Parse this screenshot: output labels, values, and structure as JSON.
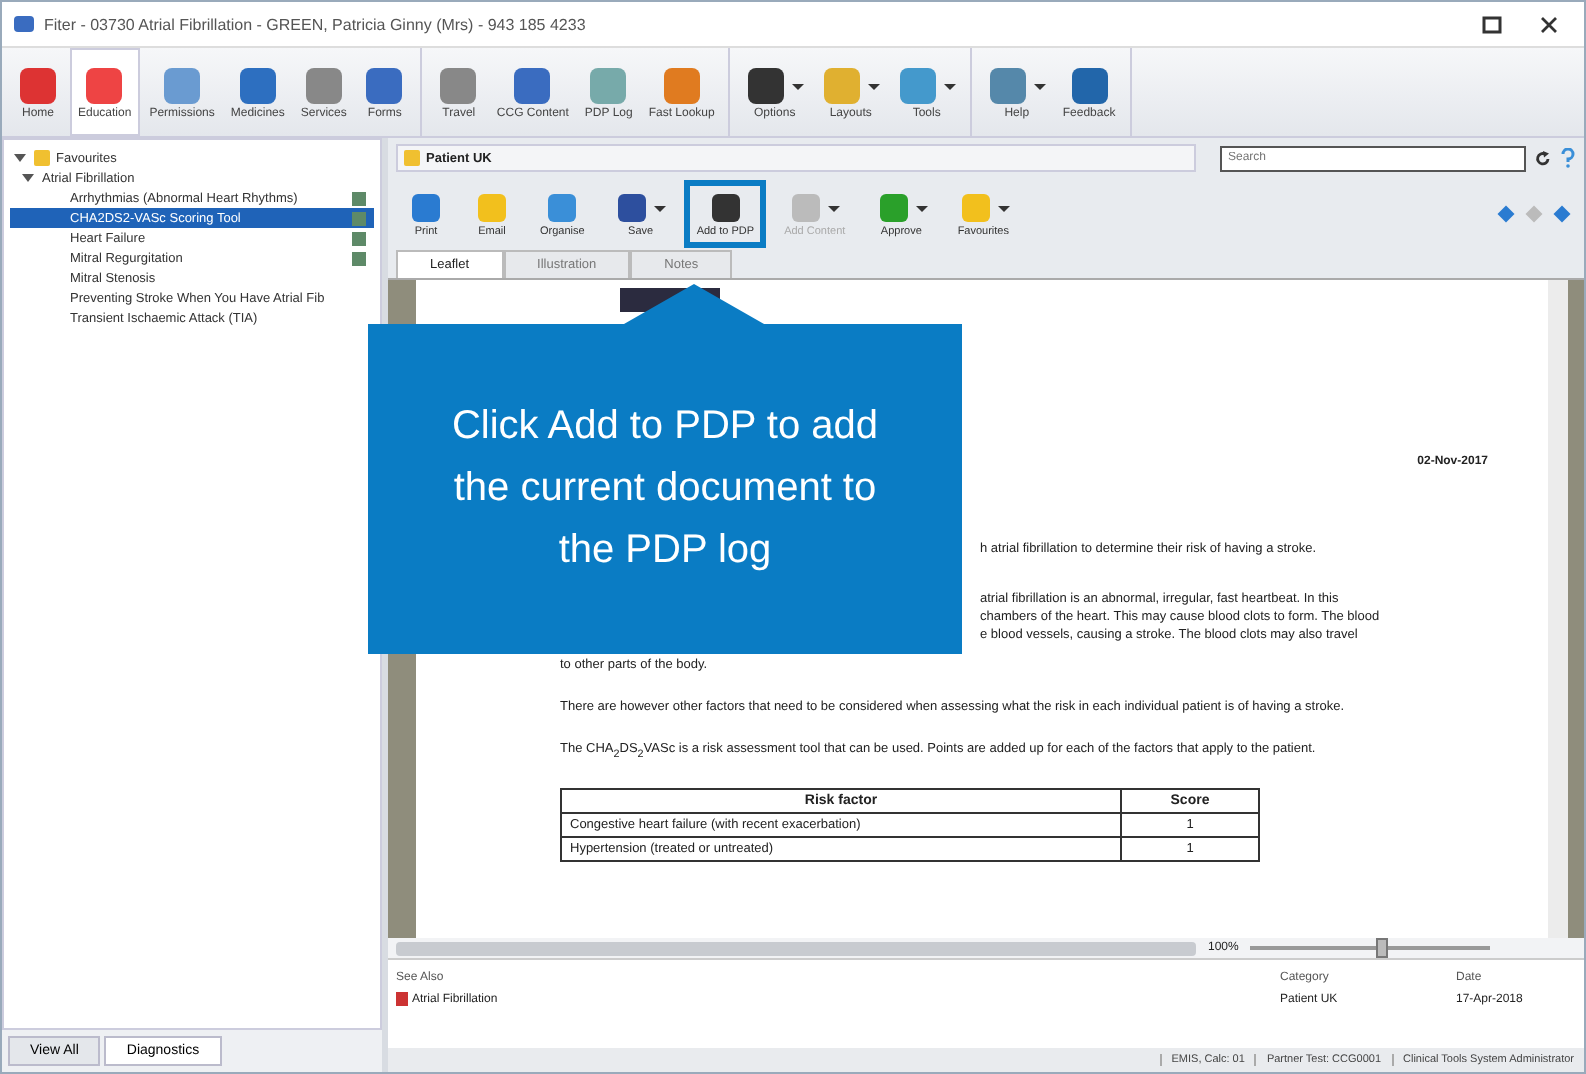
{
  "window": {
    "title": "Fiter - 03730 Atrial Fibrillation - GREEN, Patricia Ginny (Mrs) - 943 185 4233"
  },
  "ribbon": {
    "groups": [
      [
        {
          "label": "Home",
          "selected": false
        },
        {
          "label": "Education",
          "selected": true
        },
        {
          "label": "Permissions",
          "selected": false
        },
        {
          "label": "Medicines",
          "selected": false
        },
        {
          "label": "Services",
          "selected": false
        },
        {
          "label": "Forms",
          "selected": false
        }
      ],
      [
        {
          "label": "Travel",
          "selected": false
        },
        {
          "label": "CCG Content",
          "selected": false
        },
        {
          "label": "PDP Log",
          "selected": false
        },
        {
          "label": "Fast Lookup",
          "selected": false
        }
      ],
      [
        {
          "label": "Options",
          "dropdown": true
        },
        {
          "label": "Layouts",
          "dropdown": true
        },
        {
          "label": "Tools",
          "dropdown": true
        }
      ],
      [
        {
          "label": "Help",
          "dropdown": true
        },
        {
          "label": "Feedback",
          "dropdown": false
        }
      ]
    ]
  },
  "sidebar": {
    "tree": [
      {
        "label": "Favourites",
        "expanded": true,
        "children": [
          {
            "label": "Atrial Fibrillation",
            "expanded": true,
            "children": [
              {
                "label": "Arrhythmias (Abnormal Heart Rhythms)",
                "selected": false,
                "marked": true
              },
              {
                "label": "CHA2DS2-VASc Scoring Tool",
                "selected": true,
                "marked": true
              },
              {
                "label": "Heart Failure",
                "selected": false,
                "marked": true
              },
              {
                "label": "Mitral Regurgitation",
                "selected": false,
                "marked": true
              },
              {
                "label": "Mitral Stenosis",
                "selected": false,
                "marked": false
              },
              {
                "label": "Preventing Stroke When You Have Atrial Fib",
                "selected": false,
                "marked": false
              },
              {
                "label": "Transient Ischaemic Attack (TIA)",
                "selected": false,
                "marked": false
              }
            ]
          }
        ]
      }
    ],
    "buttons": [
      {
        "label": "View All",
        "selected": false
      },
      {
        "label": "Diagnostics",
        "selected": true
      }
    ]
  },
  "document": {
    "source": "Patient UK",
    "search": {
      "placeholder": "Search"
    },
    "toolbar": [
      {
        "label": "Print",
        "disabled": false,
        "dropdown": false
      },
      {
        "label": "Email",
        "disabled": false,
        "dropdown": false
      },
      {
        "label": "Organise",
        "disabled": false,
        "dropdown": false
      },
      {
        "label": "Save",
        "disabled": false,
        "dropdown": true
      },
      {
        "label": "Add to PDP",
        "disabled": false,
        "dropdown": false,
        "highlighted": true
      },
      {
        "label": "Add Content",
        "disabled": true,
        "dropdown": true
      },
      {
        "label": "Approve",
        "disabled": false,
        "dropdown": true
      },
      {
        "label": "Favourites",
        "disabled": false,
        "dropdown": true
      }
    ],
    "tabs": [
      {
        "label": "Leaflet",
        "selected": true
      },
      {
        "label": "Illustration",
        "selected": false
      },
      {
        "label": "Notes",
        "selected": false
      }
    ],
    "date": "02-Nov-2017",
    "partial_lines": [
      "h atrial fibrillation to determine their risk of having a stroke.",
      "atrial fibrillation is an abnormal, irregular, fast heartbeat. In this",
      "chambers of the heart. This may cause blood clots to form. The blood",
      "e blood vessels, causing a stroke. The blood clots may also travel"
    ],
    "paragraphs": [
      "to other parts of the body.",
      "There are however other factors that need to be considered when assessing what the risk in each individual patient is of having a stroke.",
      "The CHA$_{2}$DS$_{2}$VASc is a risk assessment tool that can be used. Points are added up for each of the factors that apply to the patient."
    ],
    "table": {
      "columns": [
        "Risk factor",
        "Score"
      ],
      "rows": [
        [
          "Congestive heart failure (with recent exacerbation)",
          "1"
        ],
        [
          "Hypertension (treated or untreated)",
          "1"
        ]
      ]
    },
    "zoom": "100%",
    "zoom_slider": {
      "level": 0.55
    },
    "see_also": {
      "columns": [
        "See Also",
        "Category",
        "Date"
      ],
      "rows": [
        [
          "Atrial Fibrillation",
          "Patient UK",
          "17-Apr-2018"
        ]
      ]
    }
  },
  "callout": {
    "text": "Click Add to PDP to add the current document to the PDP log"
  },
  "status_bar": [
    "EMIS, Calc: 01",
    "Partner Test: CCG0001",
    "Clinical Tools System Administrator"
  ]
}
